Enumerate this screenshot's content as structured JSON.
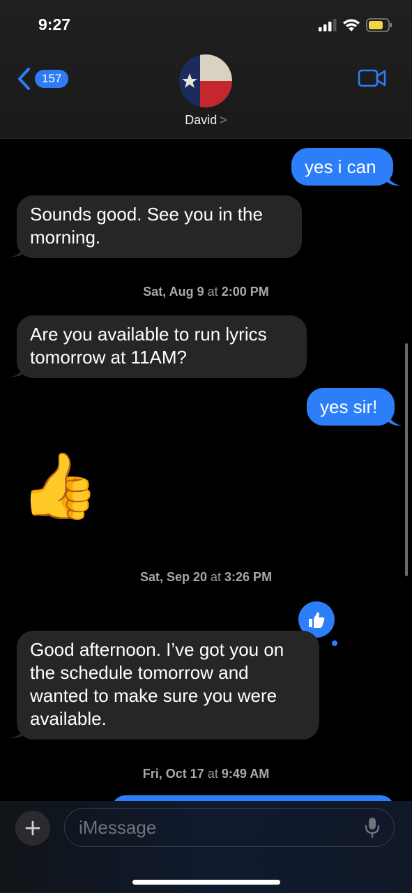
{
  "status_bar": {
    "time": "9:27"
  },
  "nav": {
    "back_badge": "157",
    "contact_name": "David",
    "chevron": ">"
  },
  "thread": {
    "msg1": "yes i can",
    "msg2": "Sounds good. See you in the morning.",
    "ts1_day": "Sat, Aug 9",
    "ts1_at": "at",
    "ts1_time": "2:00 PM",
    "msg3": "Are you available to run lyrics tomorrow at 11AM?",
    "msg4": "yes sir!",
    "emoji": "👍",
    "ts2_day": "Sat, Sep 20",
    "ts2_at": "at",
    "ts2_time": "3:26 PM",
    "msg5": "Good afternoon. I’ve got you on the schedule tomorrow and wanted to make sure you were available.",
    "ts3_day": "Fri, Oct 17",
    "ts3_at": "at",
    "ts3_time": "9:49 AM"
  },
  "composer": {
    "placeholder": "iMessage"
  },
  "colors": {
    "accent": "#2d7ff9",
    "incoming": "#262628",
    "battery": "#f5d547"
  }
}
